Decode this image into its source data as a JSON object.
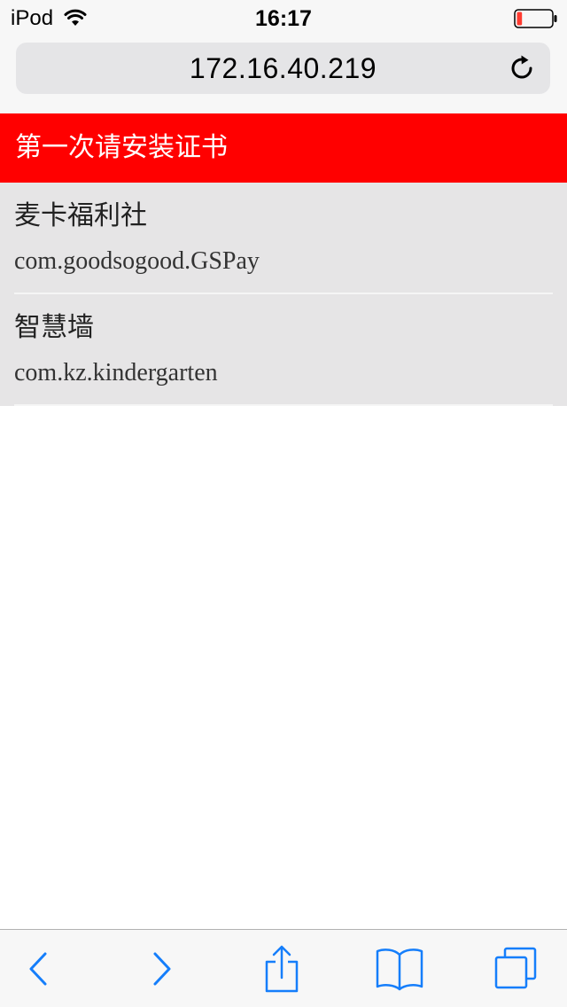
{
  "status_bar": {
    "carrier": "iPod",
    "time": "16:17",
    "battery_level": 0.15,
    "battery_color": "#ff3b30"
  },
  "address_bar": {
    "url": "172.16.40.219"
  },
  "banner": {
    "text": "第一次请安装证书",
    "color": "#ff0000"
  },
  "apps": [
    {
      "name": "麦卡福利社",
      "bundle_id": "com.goodsogood.GSPay"
    },
    {
      "name": "智慧墙",
      "bundle_id": "com.kz.kindergarten"
    }
  ],
  "toolbar": {
    "tint": "#157efb",
    "buttons": [
      "back-icon",
      "forward-icon",
      "share-icon",
      "bookmarks-icon",
      "tabs-icon"
    ]
  }
}
